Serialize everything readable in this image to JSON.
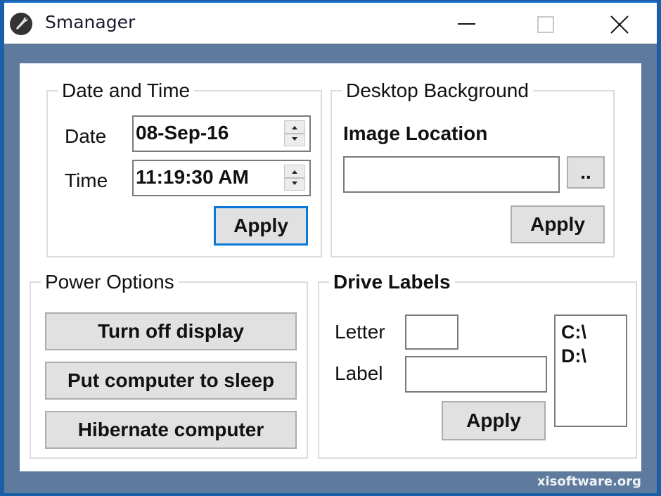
{
  "window": {
    "title": "Smanager",
    "icon": "wrench-icon",
    "controls": {
      "minimize": "minimize-icon",
      "maximize": "maximize-icon",
      "close": "close-icon"
    }
  },
  "date_time": {
    "group_label": "Date and Time",
    "date_label": "Date",
    "date_value": "08-Sep-16",
    "time_label": "Time",
    "time_value": "11:19:30 AM",
    "apply_label": "Apply"
  },
  "desktop_background": {
    "group_label": "Desktop Background",
    "image_location_label": "Image Location",
    "image_location_value": "",
    "browse_label": "..",
    "apply_label": "Apply"
  },
  "power_options": {
    "group_label": "Power Options",
    "buttons": [
      "Turn off display",
      "Put computer to sleep",
      "Hibernate computer"
    ]
  },
  "drive_labels": {
    "group_label": "Drive Labels",
    "letter_label": "Letter",
    "letter_value": "",
    "label_label": "Label",
    "label_value": "",
    "apply_label": "Apply",
    "drives": [
      "C:\\",
      "D:\\"
    ]
  },
  "watermark": "xisoftware.org",
  "colors": {
    "frame": "#5e7a9d",
    "accent": "#0a78d7",
    "button_bg": "#e1e1e1"
  }
}
